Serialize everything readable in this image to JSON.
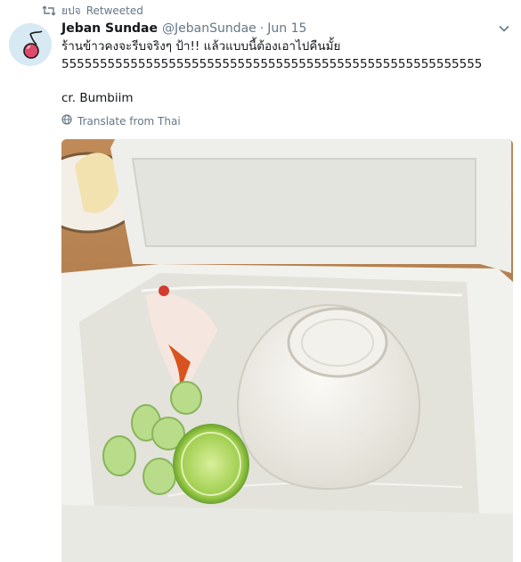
{
  "retweet": {
    "user": "ยปจ",
    "label": "Retweeted"
  },
  "tweet": {
    "display_name": "Jeban Sundae",
    "handle": "@JebanSundae",
    "separator": "·",
    "date": "Jun 15",
    "lines": [
      "ร้านข้าวคงจะรีบจริงๆ ป้า!! แล้วแบบนี้ต้องเอาไปคืนมั้ย",
      "5555555555555555555555555555555555555555555555555555555"
    ],
    "credit": "cr. Bumbiim",
    "translate_label": "Translate from Thai"
  },
  "icons": {
    "retweet": "retweet-icon",
    "avatar": "cherry-avatar-icon",
    "menu": "chevron-down-icon",
    "translate": "globe-icon"
  },
  "colors": {
    "secondary_text": "#657786",
    "primary_text": "#14171a",
    "avatar_bg": "#d7e9f3"
  }
}
